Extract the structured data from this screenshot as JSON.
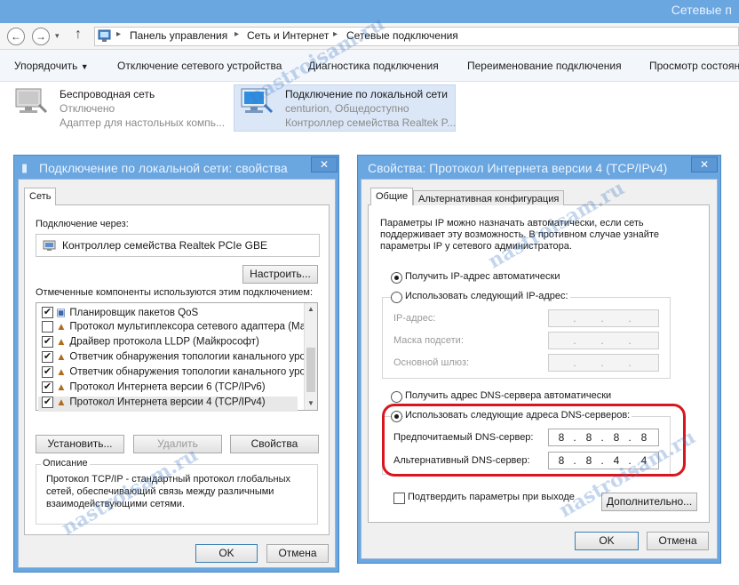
{
  "window": {
    "title": "Сетевые п"
  },
  "address": {
    "crumbs": [
      "Панель управления",
      "Сеть и Интернет",
      "Сетевые подключения"
    ]
  },
  "commands": [
    "Упорядочить",
    "Отключение сетевого устройства",
    "Диагностика подключения",
    "Переименование подключения",
    "Просмотр состоян"
  ],
  "adapters": [
    {
      "name": "Беспроводная сеть",
      "status": "Отключено",
      "device": "Адаптер для настольных компь..."
    },
    {
      "name": "Подключение по локальной сети",
      "status": "centurion, Общедоступно",
      "device": "Контроллер семейства Realtek P..."
    }
  ],
  "props": {
    "title": "Подключение по локальной сети: свойства",
    "close": "✕",
    "tab": "Сеть",
    "connect_label": "Подключение через:",
    "device": "Контроллер семейства Realtek PCIe GBE",
    "configure": "Настроить...",
    "components_label": "Отмеченные компоненты используются этим подключением:",
    "components": [
      {
        "name": "Планировщик пакетов QoS",
        "checked": "✔"
      },
      {
        "name": "Протокол мультиплексора сетевого адаптера (Май",
        "checked": ""
      },
      {
        "name": "Драйвер протокола LLDP (Майкрософт)",
        "checked": "✔"
      },
      {
        "name": "Ответчик обнаружения топологии канального уров",
        "checked": "✔"
      },
      {
        "name": "Ответчик обнаружения топологии канального уров",
        "checked": "✔"
      },
      {
        "name": "Протокол Интернета версии 6 (TCP/IPv6)",
        "checked": "✔"
      },
      {
        "name": "Протокол Интернета версии 4 (TCP/IPv4)",
        "checked": "✔"
      }
    ],
    "install": "Установить...",
    "remove": "Удалить",
    "properties": "Свойства",
    "description_title": "Описание",
    "description": "Протокол TCP/IP - стандартный протокол глобальных сетей, обеспечивающий связь между различными взаимодействующими сетями.",
    "ok": "OK",
    "cancel": "Отмена"
  },
  "ipv4": {
    "title": "Свойства: Протокол Интернета версии 4 (TCP/IPv4)",
    "close": "✕",
    "tab_general": "Общие",
    "tab_alt": "Альтернативная конфигурация",
    "intro": "Параметры IP можно назначать автоматически, если сеть поддерживает эту возможность. В противном случае узнайте параметры IP у сетевого администратора.",
    "ip_auto": "Получить IP-адрес автоматически",
    "ip_manual": "Использовать следующий IP-адрес:",
    "ip_address": "IP-адрес:",
    "mask": "Маска подсети:",
    "gateway": "Основной шлюз:",
    "dns_auto": "Получить адрес DNS-сервера автоматически",
    "dns_manual": "Использовать следующие адреса DNS-серверов:",
    "dns_pref_label": "Предпочитаемый DNS-сервер:",
    "dns_alt_label": "Альтернативный DNS-сервер:",
    "dns_pref": [
      "8",
      "8",
      "8",
      "8"
    ],
    "dns_alt": [
      "8",
      "8",
      "4",
      "4"
    ],
    "validate": "Подтвердить параметры при выходе",
    "advanced": "Дополнительно...",
    "ok": "OK",
    "cancel": "Отмена"
  },
  "watermark": "nastroisam.ru",
  "colors": {
    "titlebar": "#6aa6e0",
    "highlight": "#d9161e"
  }
}
